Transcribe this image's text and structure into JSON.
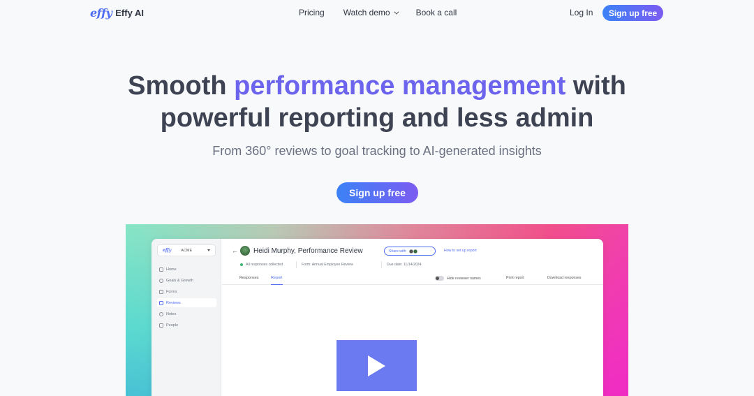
{
  "nav": {
    "logo_mark": "effy",
    "logo_text": "Effy AI",
    "links": [
      "Pricing",
      "Watch demo",
      "Book a call"
    ],
    "login": "Log In",
    "signup": "Sign up free"
  },
  "hero": {
    "title_part1": "Smooth ",
    "title_accent": "performance management",
    "title_part2": " with",
    "title_line2": "powerful reporting and less admin",
    "subtitle": "From 360° reviews to goal tracking to AI-generated insights",
    "cta": "Sign up free",
    "accent_color": "#6d64ee"
  },
  "app": {
    "org_mark": "effy",
    "org_name": "ACME",
    "sidebar": [
      {
        "label": "Home",
        "icon": "home-icon"
      },
      {
        "label": "Goals & Growth",
        "icon": "target-icon"
      },
      {
        "label": "Forms",
        "icon": "form-icon"
      },
      {
        "label": "Reviews",
        "icon": "review-icon",
        "active": true
      },
      {
        "label": "Notes",
        "icon": "note-icon"
      },
      {
        "label": "People",
        "icon": "people-icon"
      }
    ],
    "back": "←",
    "page_title": "Heidi Murphy,  Performance Review",
    "share": "Share with",
    "howto": "How to set up report",
    "meta": {
      "status": "All responses collected",
      "form": "Form: Annual Employee Review",
      "due": "Due date: 11/14/2024"
    },
    "tabs": [
      "Responses",
      "Report"
    ],
    "active_tab": "Report",
    "tools": {
      "hide": "Hide reviewer names",
      "print": "Print report",
      "download": "Download responses"
    }
  }
}
